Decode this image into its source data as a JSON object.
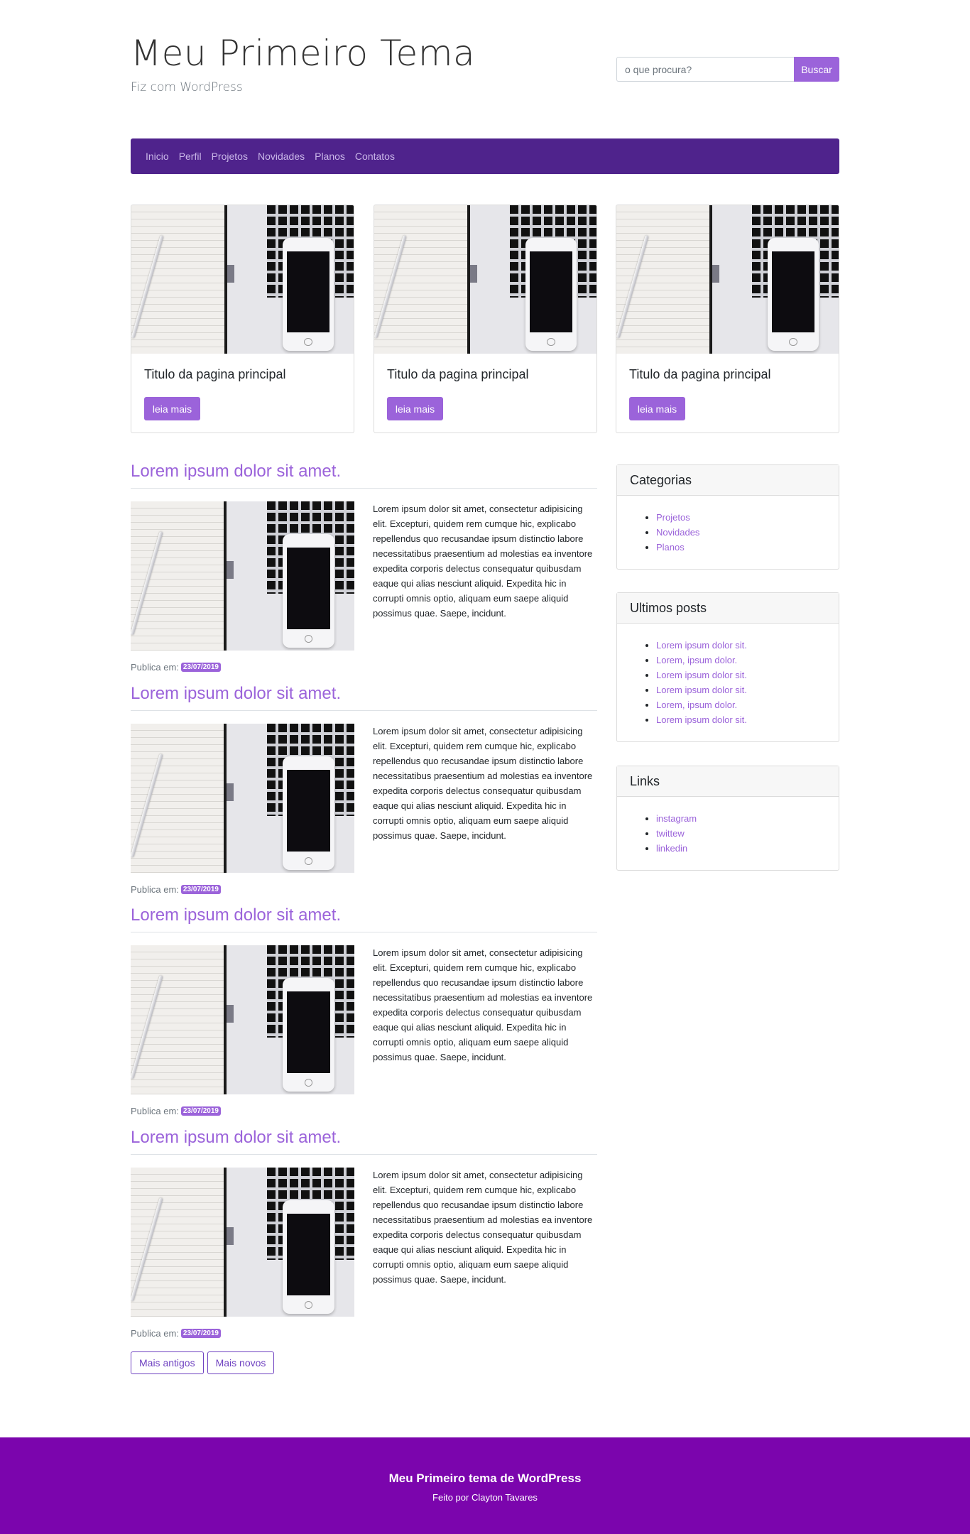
{
  "header": {
    "title": "Meu Primeiro Tema",
    "description": "Fiz com WordPress",
    "search_placeholder": "o que procura?",
    "search_button": "Buscar"
  },
  "nav": {
    "items": [
      "Inicio",
      "Perfil",
      "Projetos",
      "Novidades",
      "Planos",
      "Contatos"
    ]
  },
  "cards": [
    {
      "title": "Titulo da pagina principal",
      "button": "leia mais"
    },
    {
      "title": "Titulo da pagina principal",
      "button": "leia mais"
    },
    {
      "title": "Titulo da pagina principal",
      "button": "leia mais"
    }
  ],
  "posts": [
    {
      "title": "Lorem ipsum dolor sit amet.",
      "excerpt": "Lorem ipsum dolor sit amet, consectetur adipisicing elit. Excepturi, quidem rem cumque hic, explicabo repellendus quo recusandae ipsum distinctio labore necessitatibus praesentium ad molestias ea inventore expedita corporis delectus consequatur quibusdam eaque qui alias nesciunt aliquid. Expedita hic in corrupti omnis optio, aliquam eum saepe aliquid possimus quae. Saepe, incidunt.",
      "published_label": "Publica em:",
      "date": "23/07/2019"
    },
    {
      "title": "Lorem ipsum dolor sit amet.",
      "excerpt": "Lorem ipsum dolor sit amet, consectetur adipisicing elit. Excepturi, quidem rem cumque hic, explicabo repellendus quo recusandae ipsum distinctio labore necessitatibus praesentium ad molestias ea inventore expedita corporis delectus consequatur quibusdam eaque qui alias nesciunt aliquid. Expedita hic in corrupti omnis optio, aliquam eum saepe aliquid possimus quae. Saepe, incidunt.",
      "published_label": "Publica em:",
      "date": "23/07/2019"
    },
    {
      "title": "Lorem ipsum dolor sit amet.",
      "excerpt": "Lorem ipsum dolor sit amet, consectetur adipisicing elit. Excepturi, quidem rem cumque hic, explicabo repellendus quo recusandae ipsum distinctio labore necessitatibus praesentium ad molestias ea inventore expedita corporis delectus consequatur quibusdam eaque qui alias nesciunt aliquid. Expedita hic in corrupti omnis optio, aliquam eum saepe aliquid possimus quae. Saepe, incidunt.",
      "published_label": "Publica em:",
      "date": "23/07/2019"
    },
    {
      "title": "Lorem ipsum dolor sit amet.",
      "excerpt": "Lorem ipsum dolor sit amet, consectetur adipisicing elit. Excepturi, quidem rem cumque hic, explicabo repellendus quo recusandae ipsum distinctio labore necessitatibus praesentium ad molestias ea inventore expedita corporis delectus consequatur quibusdam eaque qui alias nesciunt aliquid. Expedita hic in corrupti omnis optio, aliquam eum saepe aliquid possimus quae. Saepe, incidunt.",
      "published_label": "Publica em:",
      "date": "23/07/2019"
    }
  ],
  "pager": {
    "older": "Mais antigos",
    "newer": "Mais novos"
  },
  "sidebar": {
    "categories": {
      "title": "Categorias",
      "items": [
        "Projetos",
        "Novidades",
        "Planos"
      ]
    },
    "recent": {
      "title": "Ultimos posts",
      "items": [
        "Lorem ipsum dolor sit.",
        "Lorem, ipsum dolor.",
        "Lorem ipsum dolor sit.",
        "Lorem ipsum dolor sit.",
        "Lorem, ipsum dolor.",
        "Lorem ipsum dolor sit."
      ]
    },
    "links": {
      "title": "Links",
      "items": [
        "instagram",
        "twittew",
        "linkedin"
      ]
    }
  },
  "footer": {
    "title": "Meu Primeiro tema de WordPress",
    "subtitle": "Feito por Clayton Tavares"
  },
  "colors": {
    "accent": "#9b63da",
    "nav_bg": "#4f238c",
    "footer_bg": "#7b05ad"
  }
}
